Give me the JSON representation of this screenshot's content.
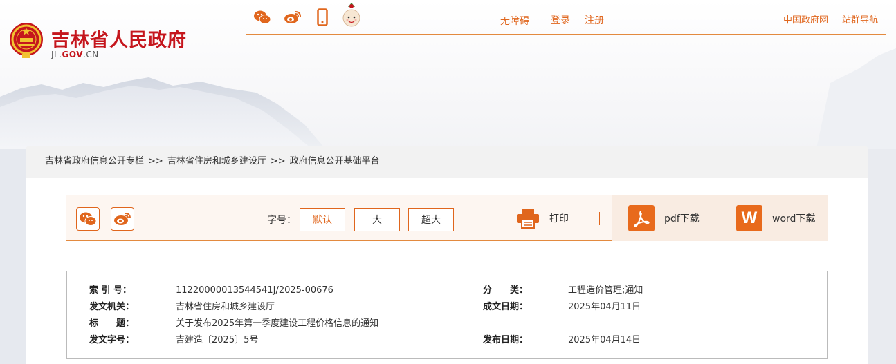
{
  "header": {
    "site_title": "吉林省人民政府",
    "site_domain_prefix": "JL.",
    "site_domain_gov": "GOV",
    "site_domain_suffix": ".CN",
    "icons": [
      "wechat-icon",
      "weibo-icon",
      "mobile-icon",
      "mascot-icon"
    ],
    "links": {
      "accessibility": "无障碍",
      "login": "登录",
      "register": "注册",
      "gov_portal": "中国政府网",
      "site_nav": "站群导航"
    }
  },
  "breadcrumb": {
    "items": [
      "吉林省政府信息公开专栏",
      "吉林省住房和城乡建设厅",
      "政府信息公开基础平台"
    ],
    "separator": ">>"
  },
  "toolbar": {
    "font_size_label": "字号：",
    "font_sizes": [
      "默认",
      "大",
      "超大"
    ],
    "print_label": "打印",
    "pdf_label": "pdf下载",
    "word_label": "word下载",
    "word_icon_letter": "W"
  },
  "info": {
    "index_label": "索 引 号：",
    "index_value": "11220000013544541J/2025-00676",
    "category_label": "分　　类：",
    "category_value": "工程造价管理;通知",
    "issuer_label": "发文机关：",
    "issuer_value": "吉林省住房和城乡建设厅",
    "created_label": "成文日期：",
    "created_value": "2025年04月11日",
    "title_label": "标　　题：",
    "title_value": "关于发布2025年第一季度建设工程价格信息的通知",
    "doc_no_label": "发文字号：",
    "doc_no_value": "吉建造〔2025〕5号",
    "published_label": "发布日期：",
    "published_value": "2025年04月14日"
  },
  "colors": {
    "brand_red": "#c5161d",
    "accent_orange": "#e0661d"
  }
}
